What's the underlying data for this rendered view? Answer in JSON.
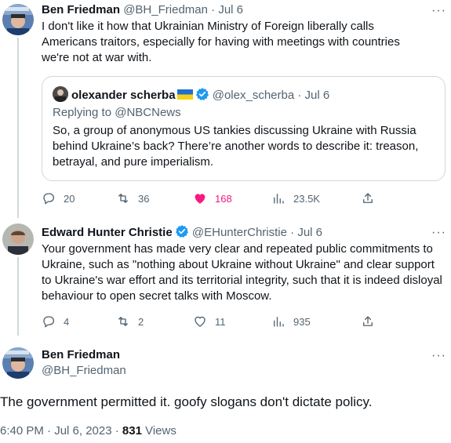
{
  "colors": {
    "accent": "#1d9bf0",
    "like": "#f91880",
    "muted": "#536471",
    "text": "#0f1419",
    "border": "#cfd9de"
  },
  "tweet1": {
    "name": "Ben Friedman",
    "handle": "@BH_Friedman",
    "dot": "·",
    "date": "Jul 6",
    "more": "···",
    "text": "I don't like it how that Ukrainian Ministry of Foreign liberally calls Americans traitors, especially for having with meetings with countries we're not at war with.",
    "quote": {
      "name": "olexander scherba",
      "handle": "@olex_scherba",
      "dot": "·",
      "date": "Jul 6",
      "replying": "Replying to @NBCNews",
      "text": "So, a group of anonymous US tankies discussing Ukraine with Russia behind Ukraine’s back? There’re another words to describe it: treason, betrayal, and pure imperialism."
    },
    "actions": {
      "replies": "20",
      "reposts": "36",
      "likes": "168",
      "views": "23.5K"
    }
  },
  "tweet2": {
    "name": "Edward Hunter Christie",
    "handle": "@EHunterChristie",
    "dot": "·",
    "date": "Jul 6",
    "more": "···",
    "text": "Your government has made very clear and repeated public commitments to Ukraine, such as \"nothing about Ukraine without Ukraine\" and clear support to Ukraine's war effort and its territorial integrity, such that it is indeed disloyal behaviour to open secret talks with Moscow.",
    "actions": {
      "replies": "4",
      "reposts": "2",
      "likes": "11",
      "views": "935"
    }
  },
  "main": {
    "name": "Ben Friedman",
    "handle": "@BH_Friedman",
    "more": "···",
    "text": "The government permitted it. goofy slogans don't dictate policy.",
    "time": "6:40 PM · Jul 6, 2023 · ",
    "views_count": "831",
    "views_label": " Views"
  }
}
